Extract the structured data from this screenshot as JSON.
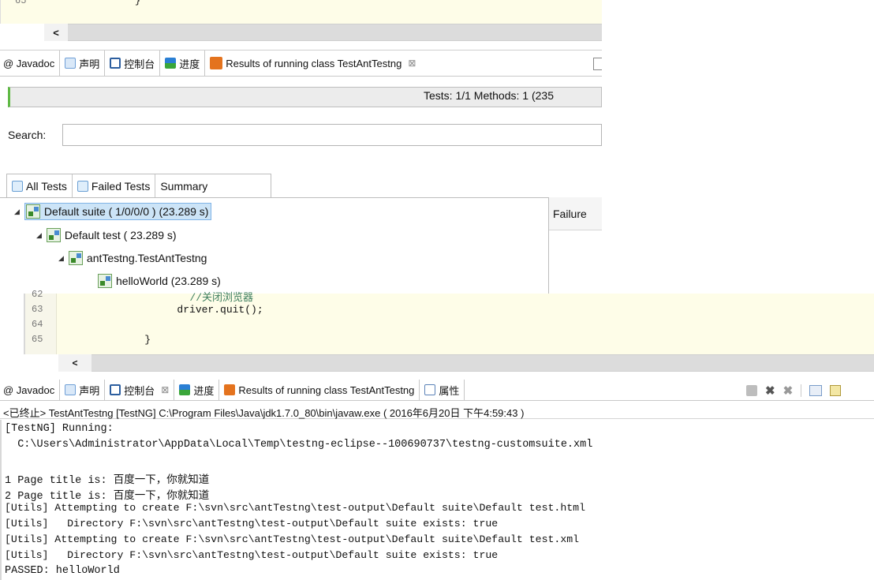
{
  "top_editor": {
    "line_number": "65",
    "scroll_arrow": "<"
  },
  "panel1": {
    "tabs": [
      {
        "label": "@ Javadoc"
      },
      {
        "label": "声明"
      },
      {
        "label": "控制台"
      },
      {
        "label": "进度"
      },
      {
        "label": "Results of running class TestAntTestng",
        "close": "⊠"
      }
    ],
    "status_text": "Tests: 1/1  Methods: 1 (235",
    "search_label": "Search:",
    "search_value": "",
    "subtabs": [
      "All Tests",
      "Failed Tests",
      "Summary"
    ],
    "tree": [
      {
        "label": "Default suite ( 1/0/0/0 ) (23.289 s)",
        "expanded": true
      },
      {
        "label": "Default test ( 23.289 s)",
        "expanded": true
      },
      {
        "label": "antTestng.TestAntTestng",
        "expanded": true
      },
      {
        "label": "helloWorld  (23.289 s)",
        "expanded": false
      }
    ],
    "failure_header": "Failure"
  },
  "editor": {
    "lines": [
      {
        "num": "62",
        "code": "        //关闭浏览器"
      },
      {
        "num": "63",
        "code": "        driver.quit();"
      },
      {
        "num": "64",
        "code": ""
      },
      {
        "num": "65",
        "code": "    }"
      }
    ],
    "scroll_arrow": "<"
  },
  "panel2": {
    "tabs": [
      {
        "label": "@ Javadoc"
      },
      {
        "label": "声明"
      },
      {
        "label": "控制台",
        "close": "⊠"
      },
      {
        "label": "进度"
      },
      {
        "label": "Results of running class TestAntTestng"
      },
      {
        "label": "属性"
      }
    ],
    "toolbar_icons": [
      "terminate-icon",
      "remove-launch-icon",
      "remove-all-icon",
      "pin-console-icon",
      "display-console-icon"
    ],
    "console_header": "<已终止> TestAntTestng [TestNG] C:\\Program Files\\Java\\jdk1.7.0_80\\bin\\javaw.exe ( 2016年6月20日 下午4:59:43 )",
    "console_lines": [
      "[TestNG] Running:",
      "  C:\\Users\\Administrator\\AppData\\Local\\Temp\\testng-eclipse--100690737\\testng-customsuite.xml",
      "",
      "1 Page title is: 百度一下，你就知道",
      "2 Page title is: 百度一下，你就知道",
      "[Utils] Attempting to create F:\\svn\\src\\antTestng\\test-output\\Default suite\\Default test.html",
      "[Utils]   Directory F:\\svn\\src\\antTestng\\test-output\\Default suite exists: true",
      "[Utils] Attempting to create F:\\svn\\src\\antTestng\\test-output\\Default suite\\Default test.xml",
      "[Utils]   Directory F:\\svn\\src\\antTestng\\test-output\\Default suite exists: true",
      "PASSED: helloWorld"
    ]
  },
  "colors": {
    "editor_bg": "#fefde8",
    "progress_green": "#5fb944",
    "selection_border": "#7fb3e6",
    "selection_bg": "#cce4f7"
  }
}
